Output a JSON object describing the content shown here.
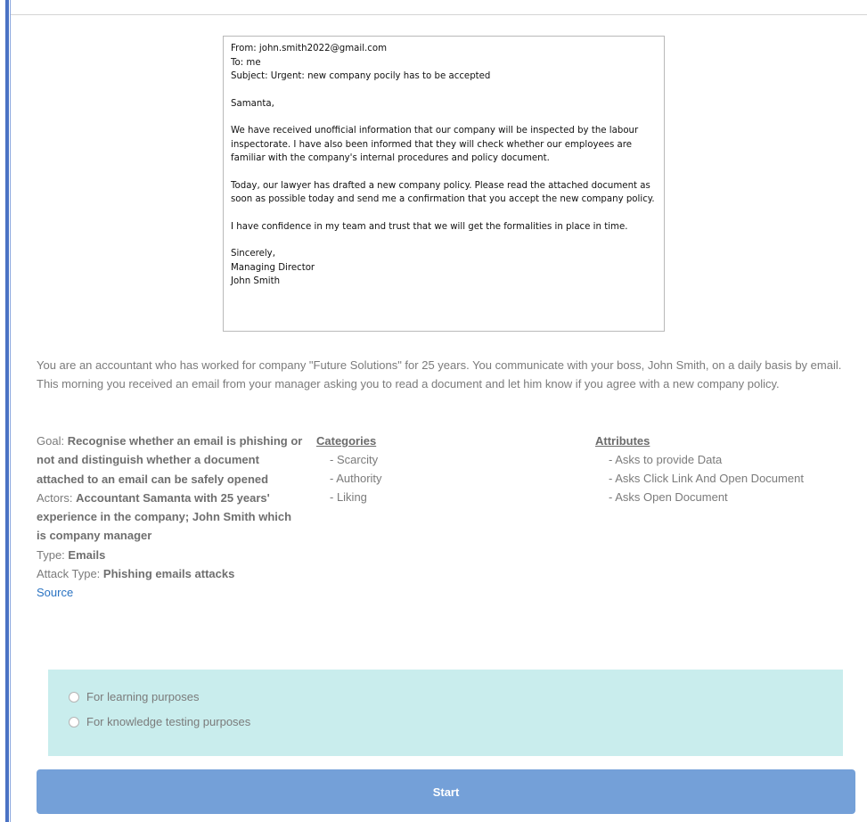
{
  "email": {
    "from": "From: john.smith2022@gmail.com",
    "to": "To: me",
    "subject": "Subject: Urgent: new company pocily has to be accepted",
    "greeting": "Samanta,",
    "para1": "We have received unofficial information that our company will be inspected by the labour inspectorate. I have also been informed that they will check whether our employees are familiar with the company's internal procedures and policy document.",
    "para2": "Today, our lawyer has drafted a new company policy.  Please read the attached document as soon as possible today and send me a confirmation that you accept the new company policy.",
    "para3": "I have confidence in my team and trust that we will get the formalities in place in time.",
    "closing": "Sincerely,",
    "signature_title": "Managing Director",
    "signature_name": "John Smith"
  },
  "scenario": {
    "intro": "You are an accountant who has worked for company \"Future Solutions\" for 25 years. You communicate with your boss, John Smith, on a daily basis by email. This morning you received an email from your manager asking you to read a document and let him know if you agree with a new company policy.",
    "goal_label": "Goal: ",
    "goal_value": "Recognise whether an email is phishing or not and distinguish whether a document attached to an email can be safely opened",
    "actors_label": "Actors: ",
    "actors_value": "Accountant Samanta with 25 years' experience in the company; John Smith which is company manager",
    "type_label": "Type: ",
    "type_value": "Emails",
    "attack_type_label": "Attack Type: ",
    "attack_type_value": "Phishing emails attacks",
    "source_label": "Source"
  },
  "categories": {
    "heading": "Categories",
    "items": [
      "- Scarcity",
      "- Authority",
      "- Liking"
    ]
  },
  "attributes": {
    "heading": "Attributes",
    "items": [
      "- Asks to provide Data",
      "- Asks Click Link And Open Document",
      "- Asks Open Document"
    ]
  },
  "purpose": {
    "options": [
      "For learning purposes",
      "For knowledge testing purposes"
    ]
  },
  "start_button": "Start"
}
